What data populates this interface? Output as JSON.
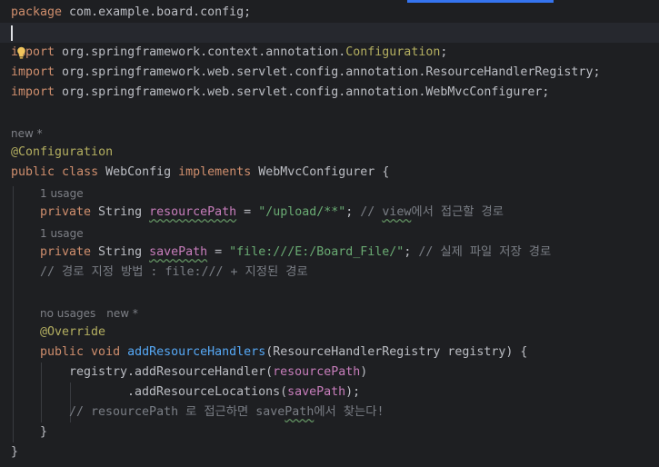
{
  "code": {
    "package_kw": "package",
    "package_name": " com.example.board.config;",
    "import_kw": "import",
    "imports": [
      {
        "path": " org.springframework.context.annotation.",
        "cls": "Configuration",
        "end": ";"
      },
      {
        "path": " org.springframework.web.servlet.config.annotation.ResourceHandlerRegistry;"
      },
      {
        "path": " org.springframework.web.servlet.config.annotation.WebMvcConfigurer;"
      }
    ],
    "hint_new": "new *",
    "annotation_configuration": "@Configuration",
    "class_decl": {
      "public": "public",
      "class": " class",
      "name": " WebConfig ",
      "implements": "implements",
      "iface": " WebMvcConfigurer {"
    },
    "hint_usage": "1 usage",
    "field1": {
      "private": "private",
      "type": " String ",
      "name": "resourcePath",
      "eq": " = ",
      "value": "\"/upload/**\"",
      "semi": ";",
      "comment_a": " // ",
      "comment_b": "view",
      "comment_c": "에서 접근할 경로"
    },
    "field2": {
      "private": "private",
      "type": " String ",
      "name": "savePath",
      "eq": " = ",
      "value": "\"file:///E:/Board_File/\"",
      "semi": ";",
      "comment": " // 실제 파일 저장 경로"
    },
    "comment_line": "// 경로 지정 방법 : file:/// + 지정된 경로",
    "hint_no_usages": "no usages",
    "annotation_override": "@Override",
    "method_decl": {
      "public": "public",
      "void": " void ",
      "name": "addResourceHandlers",
      "params": "(ResourceHandlerRegistry registry) {"
    },
    "stmt1": {
      "a": "registry.addResourceHandler(",
      "field": "resourcePath",
      "b": ")"
    },
    "stmt2": {
      "a": ".addResourceLocations(",
      "field": "savePath",
      "b": ");"
    },
    "comment_last": {
      "a": "// resourcePath 로 접근하면 save",
      "b": "Path",
      "c": "에서 찾는다!"
    },
    "close_method": "}",
    "close_class": "}"
  },
  "colors": {
    "background": "#1e1f22",
    "keyword": "#cf8e6d",
    "annotation": "#b3ae60",
    "string": "#6aab73",
    "comment": "#7a7e85",
    "field": "#c77dbb",
    "method": "#56a8f5",
    "text": "#bcbec4",
    "accent": "#3574f0"
  },
  "icons": [
    "intention-bulb-icon"
  ]
}
